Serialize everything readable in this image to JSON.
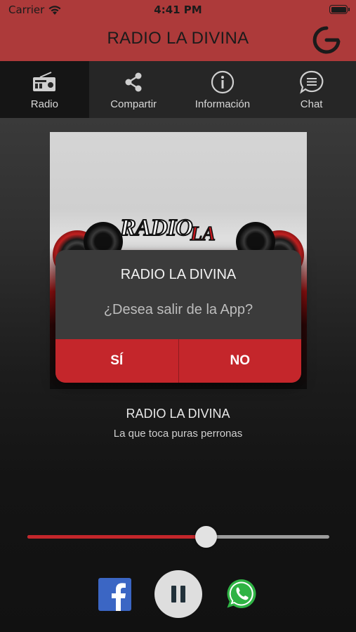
{
  "status_bar": {
    "carrier": "Carrier",
    "time": "4:41 PM",
    "wifi_icon": "wifi-icon",
    "battery_icon": "battery-icon"
  },
  "header": {
    "title": "RADIO LA DIVINA",
    "power_icon": "power-icon",
    "background_color": "#ad3a3a"
  },
  "tabs": [
    {
      "label": "Radio",
      "icon": "radio-icon",
      "active": true
    },
    {
      "label": "Compartir",
      "icon": "share-icon",
      "active": false
    },
    {
      "label": "Información",
      "icon": "info-icon",
      "active": false
    },
    {
      "label": "Chat",
      "icon": "chat-icon",
      "active": false
    }
  ],
  "artwork": {
    "logo_text_main": "RADIO",
    "logo_text_accent": "LA"
  },
  "dialog": {
    "title": "RADIO LA DIVINA",
    "message": "¿Desea salir de la App?",
    "confirm_label": "SÍ",
    "cancel_label": "NO",
    "button_color": "#c4262b"
  },
  "station": {
    "name": "RADIO LA DIVINA",
    "slogan": "La que toca puras perronas"
  },
  "volume": {
    "level": 0.59,
    "fill_color": "#c4262b"
  },
  "controls": {
    "facebook_icon": "facebook-icon",
    "pause_icon": "pause-icon",
    "whatsapp_icon": "whatsapp-icon"
  }
}
